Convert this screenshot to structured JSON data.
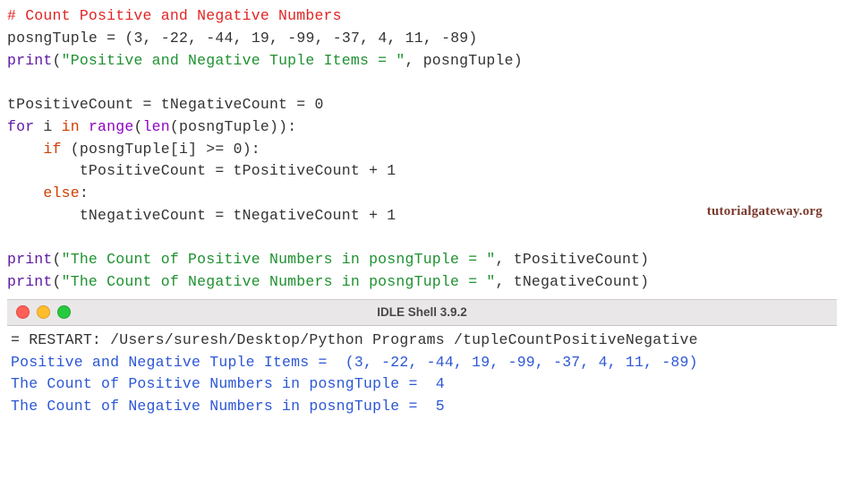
{
  "code": {
    "l1": "# Count Positive and Negative Numbers",
    "l2_a": "posngTuple = (",
    "l2_b": "3",
    "l2_c": ", -",
    "l2_d": "22",
    "l2_e": ", -",
    "l2_f": "44",
    "l2_g": ", ",
    "l2_h": "19",
    "l2_i": ", -",
    "l2_j": "99",
    "l2_k": ", -",
    "l2_l": "37",
    "l2_m": ", ",
    "l2_n": "4",
    "l2_o": ", ",
    "l2_p": "11",
    "l2_q": ", -",
    "l2_r": "89",
    "l2_s": ")",
    "l3_print": "print",
    "l3_open": "(",
    "l3_str": "\"Positive and Negative Tuple Items = \"",
    "l3_rest": ", posngTuple)",
    "l5": "tPositiveCount = tNegativeCount = ",
    "l5_zero": "0",
    "l6_for": "for",
    "l6_mid": " i ",
    "l6_in": "in",
    "l6_sp": " ",
    "l6_range": "range",
    "l6_open": "(",
    "l6_len": "len",
    "l6_rest": "(posngTuple)):",
    "l7_indent": "    ",
    "l7_if": "if",
    "l7_cond": " (posngTuple[i] >= ",
    "l7_zero": "0",
    "l7_close": "):",
    "l8": "        tPositiveCount = tPositiveCount + ",
    "l8_one": "1",
    "l9_indent": "    ",
    "l9_else": "else",
    "l9_colon": ":",
    "l10": "        tNegativeCount = tNegativeCount + ",
    "l10_one": "1",
    "l12_print": "print",
    "l12_open": "(",
    "l12_str": "\"The Count of Positive Numbers in posngTuple = \"",
    "l12_rest": ", tPositiveCount)",
    "l13_print": "print",
    "l13_open": "(",
    "l13_str": "\"The Count of Negative Numbers in posngTuple = \"",
    "l13_rest": ", tNegativeCount)"
  },
  "watermark": "tutorialgateway.org",
  "shell": {
    "title": "IDLE Shell 3.9.2",
    "restart": "= RESTART: /Users/suresh/Desktop/Python Programs /tupleCountPositiveNegative",
    "out1": "Positive and Negative Tuple Items =  (3, -22, -44, 19, -99, -37, 4, 11, -89)",
    "out2": "The Count of Positive Numbers in posngTuple =  4",
    "out3": "The Count of Negative Numbers in posngTuple =  5"
  }
}
